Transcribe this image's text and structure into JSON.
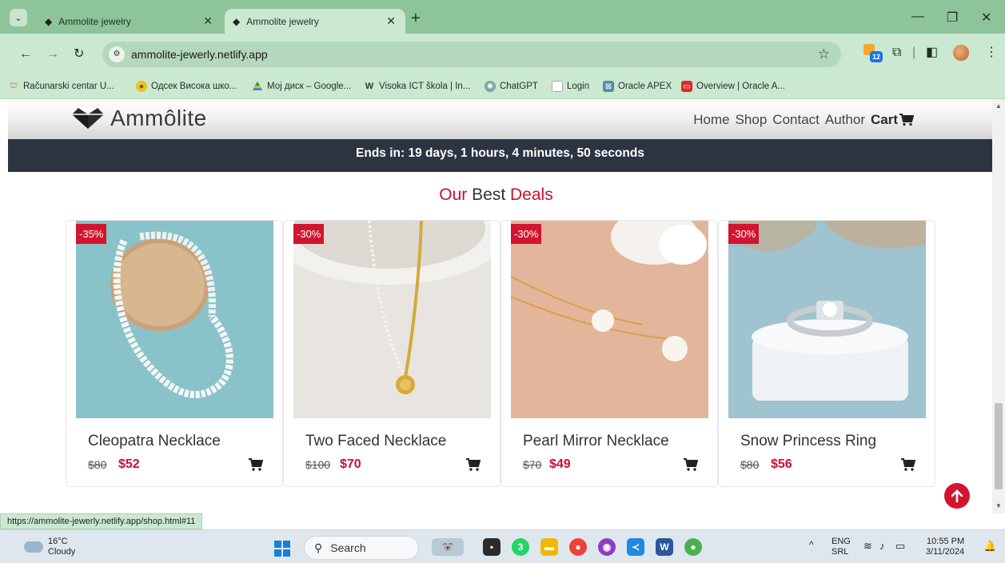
{
  "browser": {
    "tabs": [
      {
        "title": "Ammolite jewelry",
        "active": false
      },
      {
        "title": "Ammolite jewelry",
        "active": true
      }
    ],
    "url": "ammolite-jewerly.netlify.app",
    "bookmarks": [
      {
        "label": "Računarski centar U...",
        "icon": "rc-icon"
      },
      {
        "label": "Одсек Висока шко...",
        "icon": "school-icon"
      },
      {
        "label": "Мој диск – Google...",
        "icon": "drive-icon"
      },
      {
        "label": "Visoka ICT škola | In...",
        "icon": "wp-icon"
      },
      {
        "label": "ChatGPT",
        "icon": "chatgpt-icon"
      },
      {
        "label": "Login",
        "icon": "page-icon"
      },
      {
        "label": "Oracle APEX",
        "icon": "apex-icon"
      },
      {
        "label": "Overview | Oracle A...",
        "icon": "oracle-icon"
      }
    ],
    "extension_badge": "12",
    "status_url": "https://ammolite-jewerly.netlify.app/shop.html#11"
  },
  "site": {
    "brand": "Ammôlite",
    "nav": [
      "Home",
      "Shop",
      "Contact",
      "Author"
    ],
    "cart_label": "Cart",
    "countdown": "Ends in: 19 days, 1 hours, 4 minutes, 50 seconds",
    "section_title": {
      "accent1": "Our",
      "plain": " Best ",
      "accent2": "Deals"
    },
    "products": [
      {
        "name": "Cleopatra Necklace",
        "badge": "-35%",
        "old_price": "$80",
        "new_price": "$52"
      },
      {
        "name": "Two Faced Necklace",
        "badge": "-30%",
        "old_price": "$100",
        "new_price": "$70"
      },
      {
        "name": "Pearl Mirror Necklace",
        "badge": "-30%",
        "old_price": "$70",
        "new_price": "$49"
      },
      {
        "name": "Snow Princess Ring",
        "badge": "-30%",
        "old_price": "$80",
        "new_price": "$56"
      }
    ],
    "colors": {
      "accent": "#c8102e",
      "badge": "#d2152f",
      "banner": "#2b3440"
    }
  },
  "taskbar": {
    "weather_temp": "16°C",
    "weather_desc": "Cloudy",
    "search_label": "Search",
    "whatsapp_badge": "3",
    "lang": "ENG",
    "layout": "SRL",
    "time": "10:55 PM",
    "date": "3/11/2024"
  }
}
